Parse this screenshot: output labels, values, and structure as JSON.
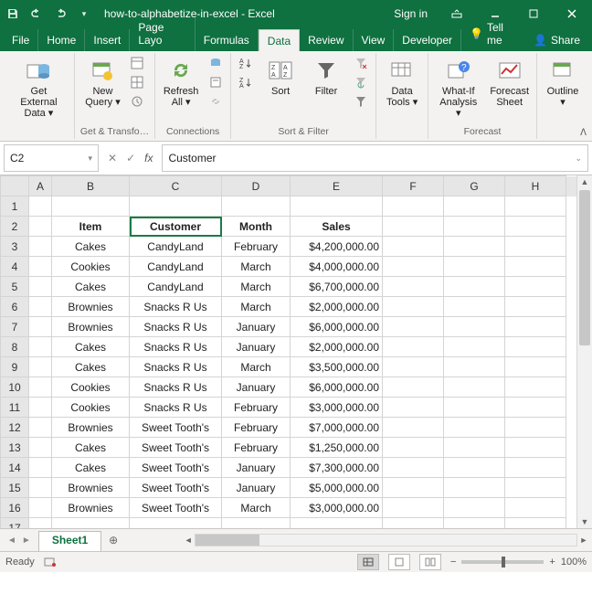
{
  "title": "how-to-alphabetize-in-excel - Excel",
  "signin": "Sign in",
  "tabs": {
    "file": "File",
    "home": "Home",
    "insert": "Insert",
    "pagelayout": "Page Layo",
    "formulas": "Formulas",
    "data": "Data",
    "review": "Review",
    "view": "View",
    "developer": "Developer",
    "tellme": "Tell me",
    "share": "Share"
  },
  "ribbon": {
    "get_external": "Get External\nData ▾",
    "new_query": "New\nQuery ▾",
    "refresh": "Refresh\nAll ▾",
    "sort": "Sort",
    "filter": "Filter",
    "data_tools": "Data\nTools ▾",
    "whatif": "What-If\nAnalysis ▾",
    "forecast": "Forecast\nSheet",
    "outline": "Outline\n▾",
    "grp_get": "Get & Transfo…",
    "grp_conn": "Connections",
    "grp_sort": "Sort & Filter",
    "grp_forecast": "Forecast"
  },
  "namebox": "C2",
  "formula": "Customer",
  "columns": [
    "",
    "A",
    "B",
    "C",
    "D",
    "E",
    "F",
    "G",
    "H"
  ],
  "headers": {
    "B": "Item",
    "C": "Customer",
    "D": "Month",
    "E": "Sales"
  },
  "rows": [
    {
      "n": 3,
      "B": "Cakes",
      "C": "CandyLand",
      "D": "February",
      "E": "$4,200,000.00"
    },
    {
      "n": 4,
      "B": "Cookies",
      "C": "CandyLand",
      "D": "March",
      "E": "$4,000,000.00"
    },
    {
      "n": 5,
      "B": "Cakes",
      "C": "CandyLand",
      "D": "March",
      "E": "$6,700,000.00"
    },
    {
      "n": 6,
      "B": "Brownies",
      "C": "Snacks R Us",
      "D": "March",
      "E": "$2,000,000.00"
    },
    {
      "n": 7,
      "B": "Brownies",
      "C": "Snacks R Us",
      "D": "January",
      "E": "$6,000,000.00"
    },
    {
      "n": 8,
      "B": "Cakes",
      "C": "Snacks R Us",
      "D": "January",
      "E": "$2,000,000.00"
    },
    {
      "n": 9,
      "B": "Cakes",
      "C": "Snacks R Us",
      "D": "March",
      "E": "$3,500,000.00"
    },
    {
      "n": 10,
      "B": "Cookies",
      "C": "Snacks R Us",
      "D": "January",
      "E": "$6,000,000.00"
    },
    {
      "n": 11,
      "B": "Cookies",
      "C": "Snacks R Us",
      "D": "February",
      "E": "$3,000,000.00"
    },
    {
      "n": 12,
      "B": "Brownies",
      "C": "Sweet Tooth's",
      "D": "February",
      "E": "$7,000,000.00"
    },
    {
      "n": 13,
      "B": "Cakes",
      "C": "Sweet Tooth's",
      "D": "February",
      "E": "$1,250,000.00"
    },
    {
      "n": 14,
      "B": "Cakes",
      "C": "Sweet Tooth's",
      "D": "January",
      "E": "$7,300,000.00"
    },
    {
      "n": 15,
      "B": "Brownies",
      "C": "Sweet Tooth's",
      "D": "January",
      "E": "$5,000,000.00"
    },
    {
      "n": 16,
      "B": "Brownies",
      "C": "Sweet Tooth's",
      "D": "March",
      "E": "$3,000,000.00"
    }
  ],
  "sheet_tab": "Sheet1",
  "status": "Ready",
  "zoom": "100%"
}
